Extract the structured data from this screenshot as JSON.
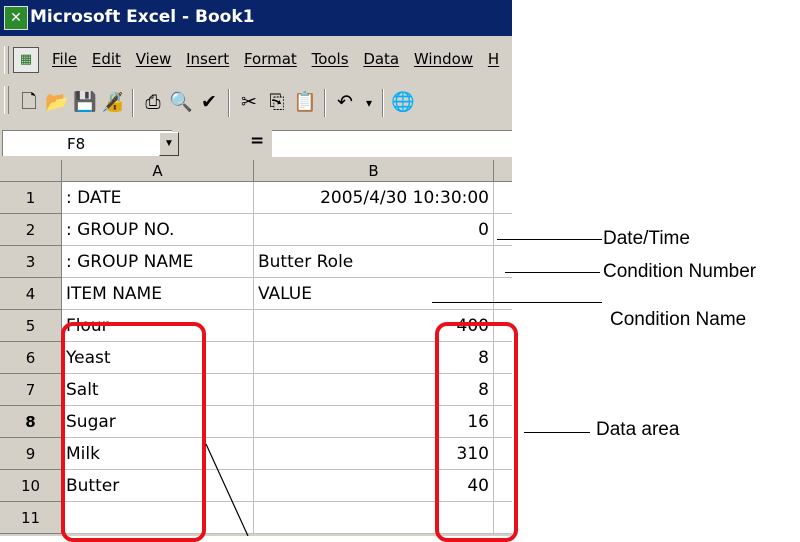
{
  "window": {
    "title": "Microsoft Excel - Book1",
    "app_icon": "excel-icon"
  },
  "menu": {
    "items": [
      "File",
      "Edit",
      "View",
      "Insert",
      "Format",
      "Tools",
      "Data",
      "Window",
      "H"
    ]
  },
  "toolbar": {
    "buttons": [
      "new-icon",
      "open-icon",
      "save-icon",
      "permission-icon",
      "print-icon",
      "print-preview-icon",
      "spelling-icon",
      "cut-icon",
      "copy-icon",
      "paste-icon",
      "undo-icon",
      "hyperlink-icon"
    ]
  },
  "formula_bar": {
    "name_box": "F8",
    "equals": "=",
    "formula": ""
  },
  "sheet": {
    "columns": [
      "A",
      "B"
    ],
    "rows": [
      {
        "num": "1",
        "a": ": DATE",
        "b": "2005/4/30 10:30:00"
      },
      {
        "num": "2",
        "a": ": GROUP NO.",
        "b": "0"
      },
      {
        "num": "3",
        "a": ": GROUP NAME",
        "b": "Butter Role"
      },
      {
        "num": "4",
        "a": "ITEM NAME",
        "b": "VALUE"
      },
      {
        "num": "5",
        "a": "Flour",
        "b": "400"
      },
      {
        "num": "6",
        "a": "Yeast",
        "b": "8"
      },
      {
        "num": "7",
        "a": "Salt",
        "b": "8"
      },
      {
        "num": "8",
        "a": "Sugar",
        "b": "16"
      },
      {
        "num": "9",
        "a": "Milk",
        "b": "310"
      },
      {
        "num": "10",
        "a": "Butter",
        "b": "40"
      },
      {
        "num": "11",
        "a": "",
        "b": ""
      }
    ]
  },
  "annotations": {
    "date_time": "Date/Time",
    "condition_number": "Condition Number",
    "condition_name": "Condition Name",
    "data_area": "Data area"
  },
  "colors": {
    "highlight": "#e8101a",
    "titlebar": "#0a246a",
    "chrome": "#d4d0c8"
  }
}
